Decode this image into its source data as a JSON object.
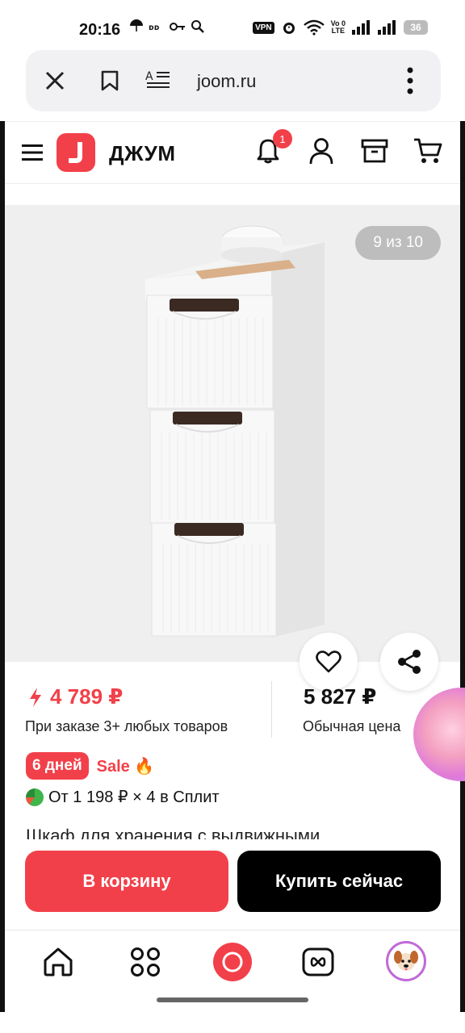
{
  "status_bar": {
    "time": "20:16",
    "vpn": "VPN",
    "volte": "Vo 0\nLTE",
    "battery": "36"
  },
  "browser": {
    "url": "joom.ru",
    "close_icon": "close-icon",
    "bookmark_icon": "bookmark-icon",
    "reader_icon": "reader-mode-icon",
    "menu_icon": "more-vert-icon"
  },
  "header": {
    "logo_text": "ДЖУМ",
    "notification_count": "1",
    "accent": "#f2404a"
  },
  "gallery": {
    "counter": "9 из 10"
  },
  "price": {
    "sale_price": "4 789 ₽",
    "sale_note": "При заказе 3+ любых товаров",
    "regular_price": "5 827 ₽",
    "regular_note": "Обычная цена"
  },
  "promo": {
    "days_badge": "6 дней",
    "sale_label": "Sale 🔥",
    "split_text": "От 1 198 ₽ × 4 в Сплит"
  },
  "product": {
    "title": "Шкаф для хранения с выдвижными"
  },
  "actions": {
    "add_to_cart": "В корзину",
    "buy_now": "Купить сейчас"
  }
}
